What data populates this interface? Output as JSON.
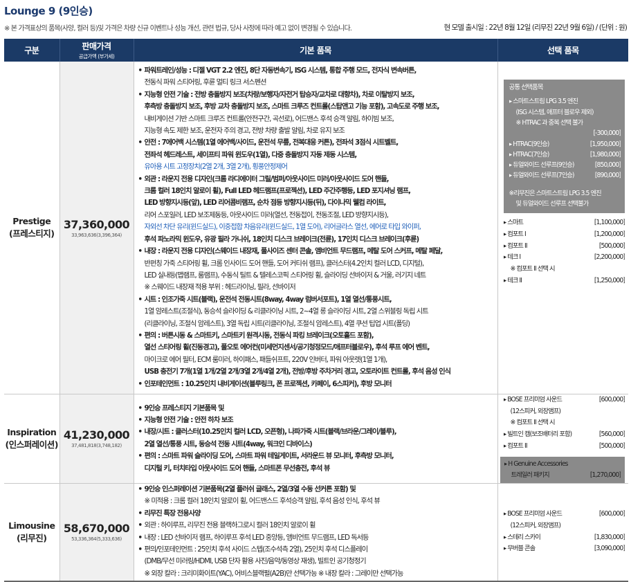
{
  "title": "Lounge 9 (9인승)",
  "note": "※ 본 가격표상의 품목(사양, 컬러 등)및 가격은 차량 신규 이벤트나 성능 개선, 관련 법규, 당사 사정에 따라 예고 없이 변경될 수 있습니다.",
  "note_right": "현 모델 출시일 : 22년 8월 12일 (리무진 22년 9월 6일)  /  (단위 : 원)",
  "headers": {
    "grade": "구분",
    "price": "판매가격",
    "price_sub": "공급가액 (부가세)",
    "basic": "기본 품목",
    "options": "선택 품목"
  },
  "rows": {
    "prestige": {
      "name_en": "Prestige",
      "name_ko": "(프레스티지)",
      "price": "37,360,000",
      "price_sub": "33,963,636(3,396,364)",
      "basic": [
        "파워트레인/성능 : 디젤 VGT 2.2 엔진, 8단 자동변속기, ISG 시스템, 통합 주행 모드, 전자식 변속버튼,",
        "전동식 파워 스티어링, 후륜 멀티 링크 서스펜션",
        "지능형 안전 기술 : 전방 충돌방지 보조(차량/보행자/자전거 탑승자/교차로 대향차), 차로 이탈방지 보조,",
        "후측방 충돌방지 보조, 후방 교차 충돌방지 보조, 스마트 크루즈 컨트롤(스탑앤고 기능 포함), 고속도로 주행 보조,",
        "내비게이션 기반 스마트 크루즈 컨트롤(안전구간, 곡선로), 어드밴스 후석 승객 알림, 하이빔 보조,",
        "지능형 속도 제한 보조, 운전자 주의 경고, 전방 차량 출발 알림, 차로 유지 보조",
        "안전 : 7에어백 시스템(1열 에어백/사이드, 운전석 무릎, 전복대응 커튼), 전좌석 3점식 시트벨트,",
        "전좌석 헤드레스트, 세이프티 파워 윈도우(1열), 다중 충돌방지 자동 제동 시스템,",
        "유아용 시트 고정장치(2열 2개, 3열 2개), 횡풍안정제어",
        "외관 : 라운지 전용 디자인(크롬 라디에이터 그릴/범퍼/아웃사이드 미러/아웃사이드 도어 핸들,",
        "크롬 컬러 18인치 알로이 휠), Full LED 헤드램프(프로젝션), LED 주간주행등, LED 포지셔닝 램프,",
        "LED 방향지시등(앞), LED 리어콤비램프, 순차 점등 방향지시등(뒤), 다이나믹 웰컴 라이트,",
        "리어 스포일러, LED 보조제동등, 아웃사이드 미러(열선, 전동접이, 전동조절, LED 방향지시등),",
        "자외선 차단 유리(윈드실드), 이중접합 차음유리(윈드실드, 1열 도어), 리어글라스 열선, 에어로 타입 와이퍼,",
        "후석 파노라믹 윈도우, 유광 필라 가니쉬, 18인치 디스크 브레이크(전륜), 17인치 디스크 브레이크(후륜)",
        "내장 : 라운지 전용 디자인(스웨이드 내장재, 풀사이즈 센터 콘솔, 앰비언트 무드램프, 메탈 도어 스커프, 메탈 페달,",
        "반펀칭 가죽 스티어링 휠, 크롬 인사이드 도어 핸들, 도어 커티쉬 램프), 클러스터(4.2인치 컬러 LCD, 디지털),",
        "LED 실내등(맵램프, 룸램프), 수동식 틸트 & 텔레스코픽 스티어링 휠, 슬라이딩 선바이저 & 거울, 러기지 네트",
        "※ 스웨이드 내장재 적용 부위 : 헤드라이닝, 필라, 선바이저",
        "시트 : 인조가죽 시트(블랙), 운전석 전동시트(8way, 4way 럼버서포트), 1열 열선/통풍시트,",
        "1열 암레스트(조절식), 동승석 슬라이딩 & 리클라이닝 시트, 2~4열 롱 슬라이딩 시트, 2열 스위블링 독립 시트",
        "(리클라이닝, 조절식 암레스트), 3열 독립 시트(리클라이닝, 조절식 암레스트), 4열 쿠션 팁업 시트(폴딩)",
        "편의 : 버튼시동 & 스마트키, 스마트키 원격시동, 전동식 파킹 브레이크(오토홀드 포함),",
        "열선 스티어링 휠(진동경고), 풀오토 에어컨(미세먼지센서/공기청정모드/애프터블로우), 후석 루프 에어 벤트,",
        "마이크로 에어 필터, ECM 룸미러, 하이패스, 패들쉬프트, 220V 인버터, 파워 아웃렛(1열 1개),",
        "USB 충전기 7개(1열 1개/2열 2개/3열 2개/4열 2개), 전방/후방 주차거리 경고, 오토라이트 컨트롤, 후석 음성 인식",
        "인포테인먼트 : 10.25인치 내비게이션(블루링크, 폰 프로젝션, 카페이, 6스피커), 후방 모니터"
      ],
      "options": {
        "common_title": "공통 선택품목",
        "common_items": [
          "▸ 스마트스트림 LPG 3.5 엔진",
          "(ISG 시스템, 애프터 블로우 제외)",
          "※ HTRAC 과 중복 선택 불가",
          "[-300,000]",
          "▸ HTRAC(9인승)",
          "[1,950,000]",
          "▸ HTRAC(7인승)",
          "[1,980,000]",
          "▸ 듀얼와이드 선루프(9인승)",
          "[850,000]",
          "▸ 듀얼와이드 선루프(7인승)",
          "[890,000]",
          "※리무진은 스마트스트림 LPG 3.5 엔진",
          "및 듀얼와이드 선루프 선택불가"
        ],
        "items": [
          {
            "name": "▸ 스마트",
            "price": "[1,100,000]"
          },
          {
            "name": "▸ 컴포트 I",
            "price": "[1,200,000]"
          },
          {
            "name": "▸ 컴포트 II",
            "price": "[500,000]"
          },
          {
            "name": "▸ 테크 I",
            "price": "[2,200,000]"
          },
          {
            "name": "※ 컴포트 II 선택 시",
            "price": ""
          },
          {
            "name": "▸ 테크 II",
            "price": "[1,250,000]"
          }
        ]
      }
    },
    "inspiration": {
      "name_en": "Inspiration",
      "name_ko": "(인스퍼레이션)",
      "price": "41,230,000",
      "price_sub": "37,481,818(3,748,182)",
      "basic": [
        "9인승 프레스티지 기본품목 및",
        "지능형 안전 기술 : 안전 하차 보조",
        "내장/시트 : 클러스터(10.25인치 컬러 LCD, 오픈형), 나파가죽 시트(블랙/브라운/그레이/블루),",
        "2열 열선/통풍 시트, 동승석 전동 시트(4way, 워크인 디바이스)",
        "편의 : 스마트 파워 슬라이딩 도어, 스마트 파워 테일게이트, 서라운드 뷰 모니터, 후측방 모니터,",
        "디지털 키, 터치타입 아웃사이드 도어 핸들, 스마트폰 무선충전, 후석 뷰"
      ],
      "options": {
        "items": [
          {
            "name": "▸ BOSE 프리미엄 사운드",
            "price": "[600,000]"
          },
          {
            "name": "(12스피커, 외장앰프)",
            "price": ""
          },
          {
            "name": "※ 컴포트 II 선택 시",
            "price": ""
          },
          {
            "name": "▸ 빌트인 캠(보조배터리 포함)",
            "price": "[560,000]"
          },
          {
            "name": "▸ 컴포트 II",
            "price": "[500,000]"
          }
        ],
        "h_title": "▸ H Genuine Accessories",
        "h_name": "트레일러 패키지",
        "h_price": "[1,270,000]"
      }
    },
    "limousine": {
      "name_en": "Limousine",
      "name_ko": "(리무진)",
      "price": "58,670,000",
      "price_sub": "53,336,364(5,333,636)",
      "basic": [
        "9인승 인스퍼레이션 기본품목(2열 플러쉬 글래스, 2열/3열 수동 선커튼 포함) 및",
        "※ 미적용 : 크롬 컬러 18인치 알로이 휠, 어드밴스드 후석승객 알림, 후석 음성 인식, 후석 뷰",
        "리무진 특장 전용사양",
        "외관 : 하이루프, 리무진 전용 블랙하그로시 컬러 18인치 알로이 휠",
        "내장 : LED 선바이저 램프, 하이루프 후석 LED 중앙등, 앰비언트 무드램프, LED 독서등",
        "편의/인포테인먼트 : 25인치 후석 사이드 스텝(조수석측 2열), 25인치 후석 디스플레이",
        "(DMB/무선 미러링/HDMI, USB 단자 활용 사진/음악/동영상 재생), 빌트인 공기청정기",
        "※ 외장 칼라 : 크리미화이트(YAC), 어비스블랙펄(A2B)만 선택가능     ※ 내장 칼라 : 그레이만 선택가능"
      ],
      "options": {
        "items": [
          {
            "name": "▸ BOSE 프리미엄 사운드",
            "price": "[600,000]"
          },
          {
            "name": "(12스피커, 외장앰프)",
            "price": ""
          },
          {
            "name": "▸ 스테리 스카이",
            "price": "[1,830,000]"
          },
          {
            "name": "▸ 무버블 콘솔",
            "price": "[3,090,000]"
          }
        ]
      }
    }
  },
  "colors": {
    "header_bg": "#1b3a66",
    "title": "#1c3a6e",
    "price_bg": "#f0f0f0",
    "option_box": "#8a8a8a",
    "highlight_blue": "#1e5eb8"
  }
}
